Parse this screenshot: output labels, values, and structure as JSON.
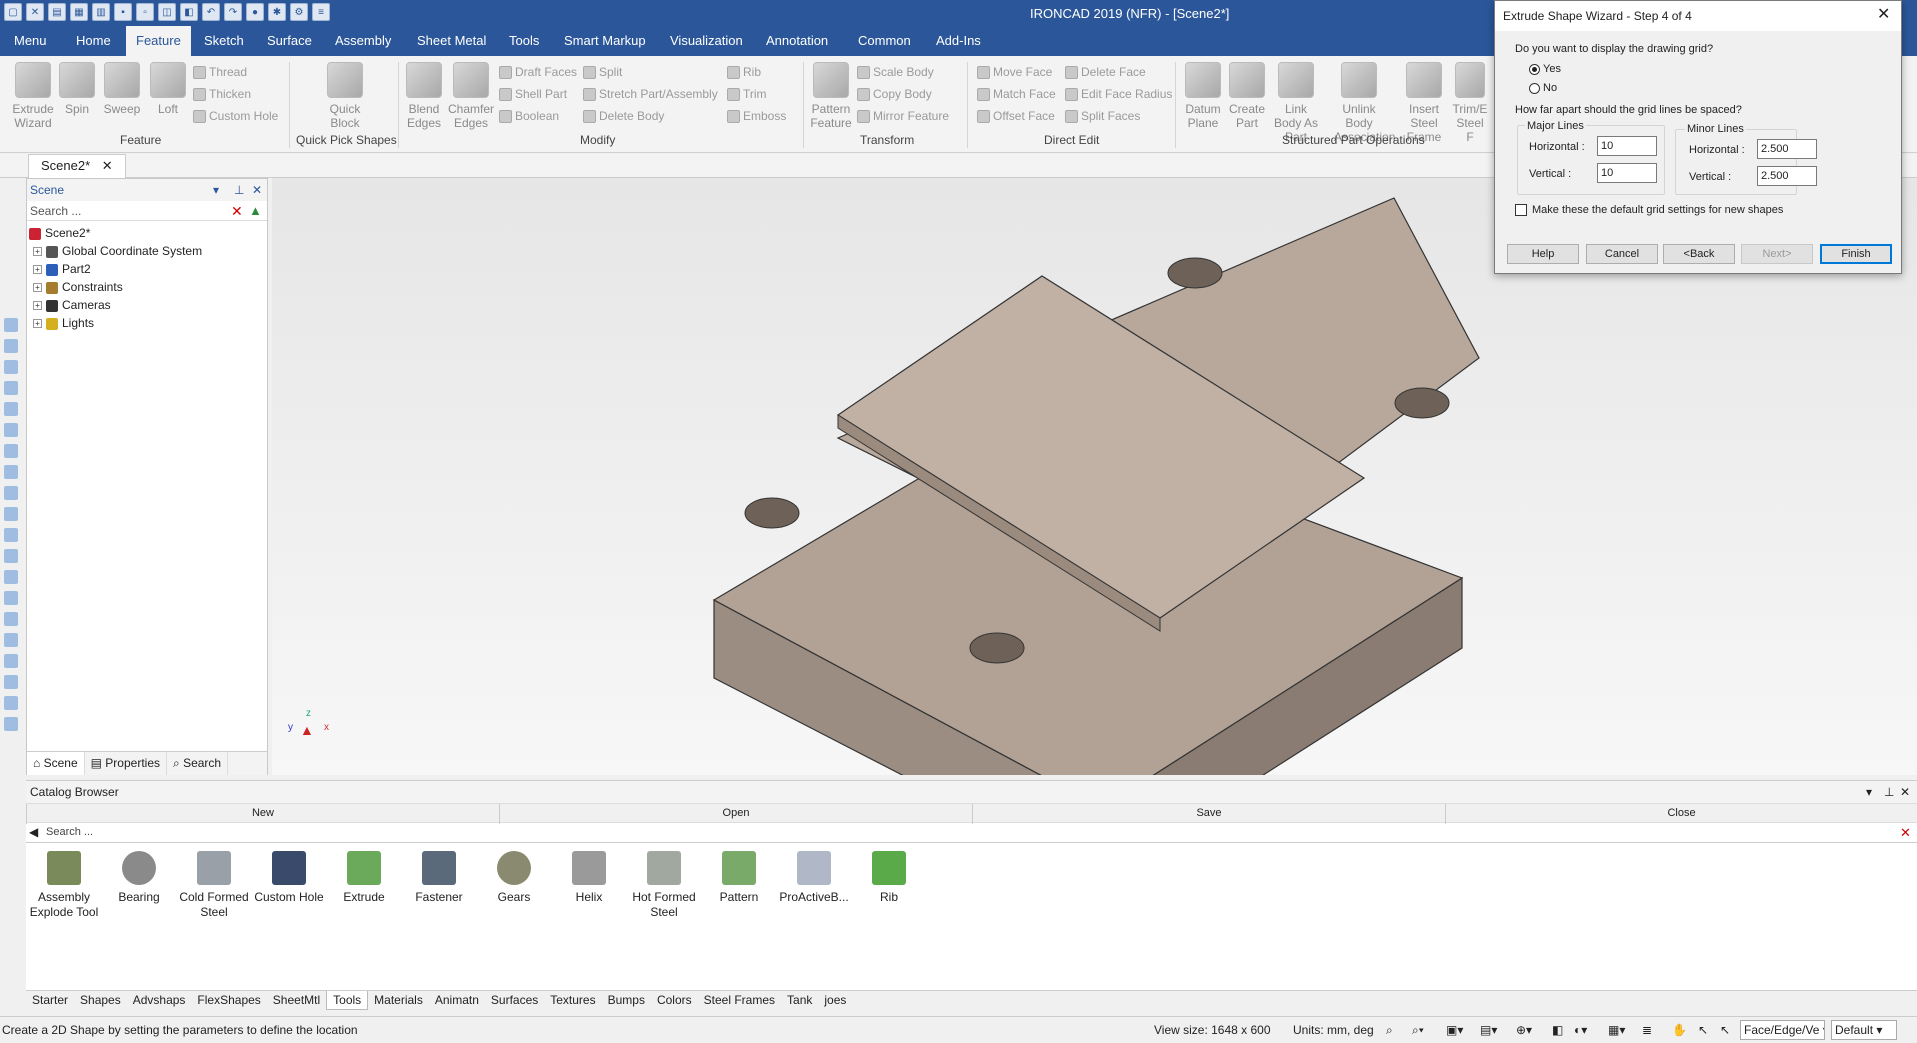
{
  "app": {
    "title": "IRONCAD 2019 (NFR) - [Scene2*]"
  },
  "menu": {
    "items": [
      "Menu",
      "Home",
      "Feature",
      "Sketch",
      "Surface",
      "Assembly",
      "Sheet Metal",
      "Tools",
      "Smart Markup",
      "Visualization",
      "Annotation",
      "Common",
      "Add-Ins"
    ],
    "active": "Feature"
  },
  "ribbon": {
    "feature": {
      "extrude": "Extrude Wizard",
      "spin": "Spin",
      "sweep": "Sweep",
      "loft": "Loft",
      "thread": "Thread",
      "thicken": "Thicken",
      "custom_hole": "Custom Hole",
      "group": "Feature"
    },
    "quickpick": {
      "quick_block": "Quick Block",
      "group": "Quick Pick Shapes"
    },
    "modify": {
      "blend": "Blend Edges",
      "chamfer": "Chamfer Edges",
      "draft": "Draft Faces",
      "shell": "Shell Part",
      "boolean": "Boolean",
      "split": "Split",
      "stretch": "Stretch Part/Assembly",
      "delete_body": "Delete Body",
      "rib": "Rib",
      "trim": "Trim",
      "emboss": "Emboss",
      "group": "Modify"
    },
    "transform": {
      "pattern": "Pattern Feature",
      "scale": "Scale Body",
      "copy": "Copy Body",
      "mirror": "Mirror Feature",
      "group": "Transform"
    },
    "direct": {
      "move_face": "Move Face",
      "match_face": "Match Face",
      "offset_face": "Offset Face",
      "delete_face": "Delete Face",
      "edit_radius": "Edit Face Radius",
      "split_faces": "Split Faces",
      "group": "Direct Edit"
    },
    "structured": {
      "datum": "Datum Plane",
      "create_part": "Create Part",
      "link_body": "Link Body As Part",
      "unlink_body": "Unlink Body Association",
      "insert_steel": "Insert Steel Frame",
      "trim_steel": "Trim/E Steel F",
      "group": "Structured Part Operations"
    }
  },
  "document": {
    "tab": "Scene2*"
  },
  "scene": {
    "header": "Scene",
    "search_placeholder": "Search ...",
    "tree": [
      "Scene2*",
      "Global Coordinate System",
      "Part2",
      "Constraints",
      "Cameras",
      "Lights"
    ],
    "tabs": [
      "Scene",
      "Properties",
      "Search"
    ]
  },
  "dialog": {
    "title": "Extrude Shape Wizard - Step 4 of 4",
    "q1": "Do you want to display the drawing grid?",
    "yes": "Yes",
    "no": "No",
    "q2": "How far apart should the grid lines be spaced?",
    "major_title": "Major Lines",
    "minor_title": "Minor Lines",
    "horizontal": "Horizontal :",
    "vertical": "Vertical :",
    "major_h": "10",
    "major_v": "10",
    "minor_h": "2.500",
    "minor_v": "2.500",
    "default_check": "Make these the default grid settings for new shapes",
    "buttons": {
      "help": "Help",
      "cancel": "Cancel",
      "back": "<Back",
      "next": "Next>",
      "finish": "Finish"
    }
  },
  "catalog": {
    "title": "Catalog Browser",
    "actions": [
      "New",
      "Open",
      "Save",
      "Close"
    ],
    "search_placeholder": "Search ...",
    "items": [
      {
        "label": "Assembly Explode Tool",
        "color": "#7a8a5a"
      },
      {
        "label": "Bearing",
        "color": "#8a8a8a"
      },
      {
        "label": "Cold Formed Steel",
        "color": "#9aa0a8"
      },
      {
        "label": "Custom Hole",
        "color": "#3a4a6a"
      },
      {
        "label": "Extrude",
        "color": "#6aaa5a"
      },
      {
        "label": "Fastener",
        "color": "#5a6a7a"
      },
      {
        "label": "Gears",
        "color": "#8a8a70"
      },
      {
        "label": "Helix",
        "color": "#9a9a9a"
      },
      {
        "label": "Hot Formed Steel",
        "color": "#a0a8a0"
      },
      {
        "label": "Pattern",
        "color": "#7aaa6a"
      },
      {
        "label": "ProActiveB...",
        "color": "#b0b8c8"
      },
      {
        "label": "Rib",
        "color": "#5aaa4a"
      }
    ],
    "tabs": [
      "Starter",
      "Shapes",
      "Advshaps",
      "FlexShapes",
      "SheetMtl",
      "Tools",
      "Materials",
      "Animatn",
      "Surfaces",
      "Textures",
      "Bumps",
      "Colors",
      "Steel Frames",
      "Tank",
      "joes"
    ],
    "active_tab": "Tools"
  },
  "status": {
    "message": "Create a 2D Shape by setting the parameters to define the location",
    "view_size": "View size: 1648 x  600",
    "units": "Units: mm, deg",
    "select_mode": "Face/Edge/Ve",
    "style": "Default"
  },
  "axis": {
    "z": "z",
    "x": "x",
    "y": "y"
  }
}
